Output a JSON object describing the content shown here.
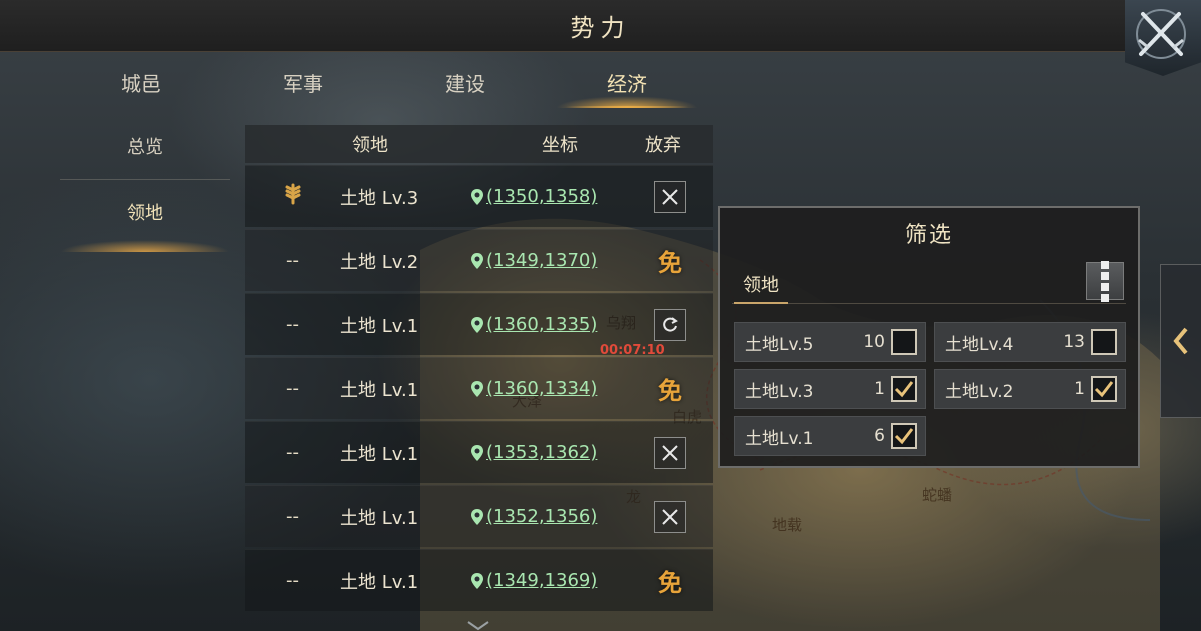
{
  "header": {
    "title": "势力"
  },
  "tabs": [
    {
      "label": "城邑"
    },
    {
      "label": "军事"
    },
    {
      "label": "建设"
    },
    {
      "label": "经济"
    }
  ],
  "active_tab": "经济",
  "sidenav": [
    {
      "label": "总览"
    },
    {
      "label": "领地"
    }
  ],
  "table": {
    "headers": {
      "land": "领地",
      "coord": "坐标",
      "abandon": "放弃"
    },
    "rows": [
      {
        "flag": "wheat-icon",
        "name": "土地 Lv.3",
        "coord": "(1350,1358)",
        "action": "close"
      },
      {
        "flag": "--",
        "name": "土地 Lv.2",
        "coord": "(1349,1370)",
        "action": "免"
      },
      {
        "flag": "--",
        "name": "土地 Lv.1",
        "coord": "(1360,1335)",
        "action": "refresh",
        "countdown": "00:07:10"
      },
      {
        "flag": "--",
        "name": "土地 Lv.1",
        "coord": "(1360,1334)",
        "action": "免"
      },
      {
        "flag": "--",
        "name": "土地 Lv.1",
        "coord": "(1353,1362)",
        "action": "close"
      },
      {
        "flag": "--",
        "name": "土地 Lv.1",
        "coord": "(1352,1356)",
        "action": "close"
      },
      {
        "flag": "--",
        "name": "土地 Lv.1",
        "coord": "(1349,1369)",
        "action": "免"
      }
    ]
  },
  "map_labels": [
    "乌翔",
    "大泽",
    "白虎",
    "龙",
    "蛇蟠",
    "地载"
  ],
  "filter": {
    "title": "筛选",
    "tab": "领地",
    "items": [
      {
        "label": "土地Lv.5",
        "count": "10",
        "checked": false
      },
      {
        "label": "土地Lv.4",
        "count": "13",
        "checked": false
      },
      {
        "label": "土地Lv.3",
        "count": "1",
        "checked": true
      },
      {
        "label": "土地Lv.2",
        "count": "1",
        "checked": true
      },
      {
        "label": "土地Lv.1",
        "count": "6",
        "checked": true
      }
    ]
  },
  "colors": {
    "accent_gold": "#f0b24a",
    "coord_green": "#a9e6b0",
    "free_orange": "#e8a43a",
    "countdown_red": "#e14a3a"
  }
}
